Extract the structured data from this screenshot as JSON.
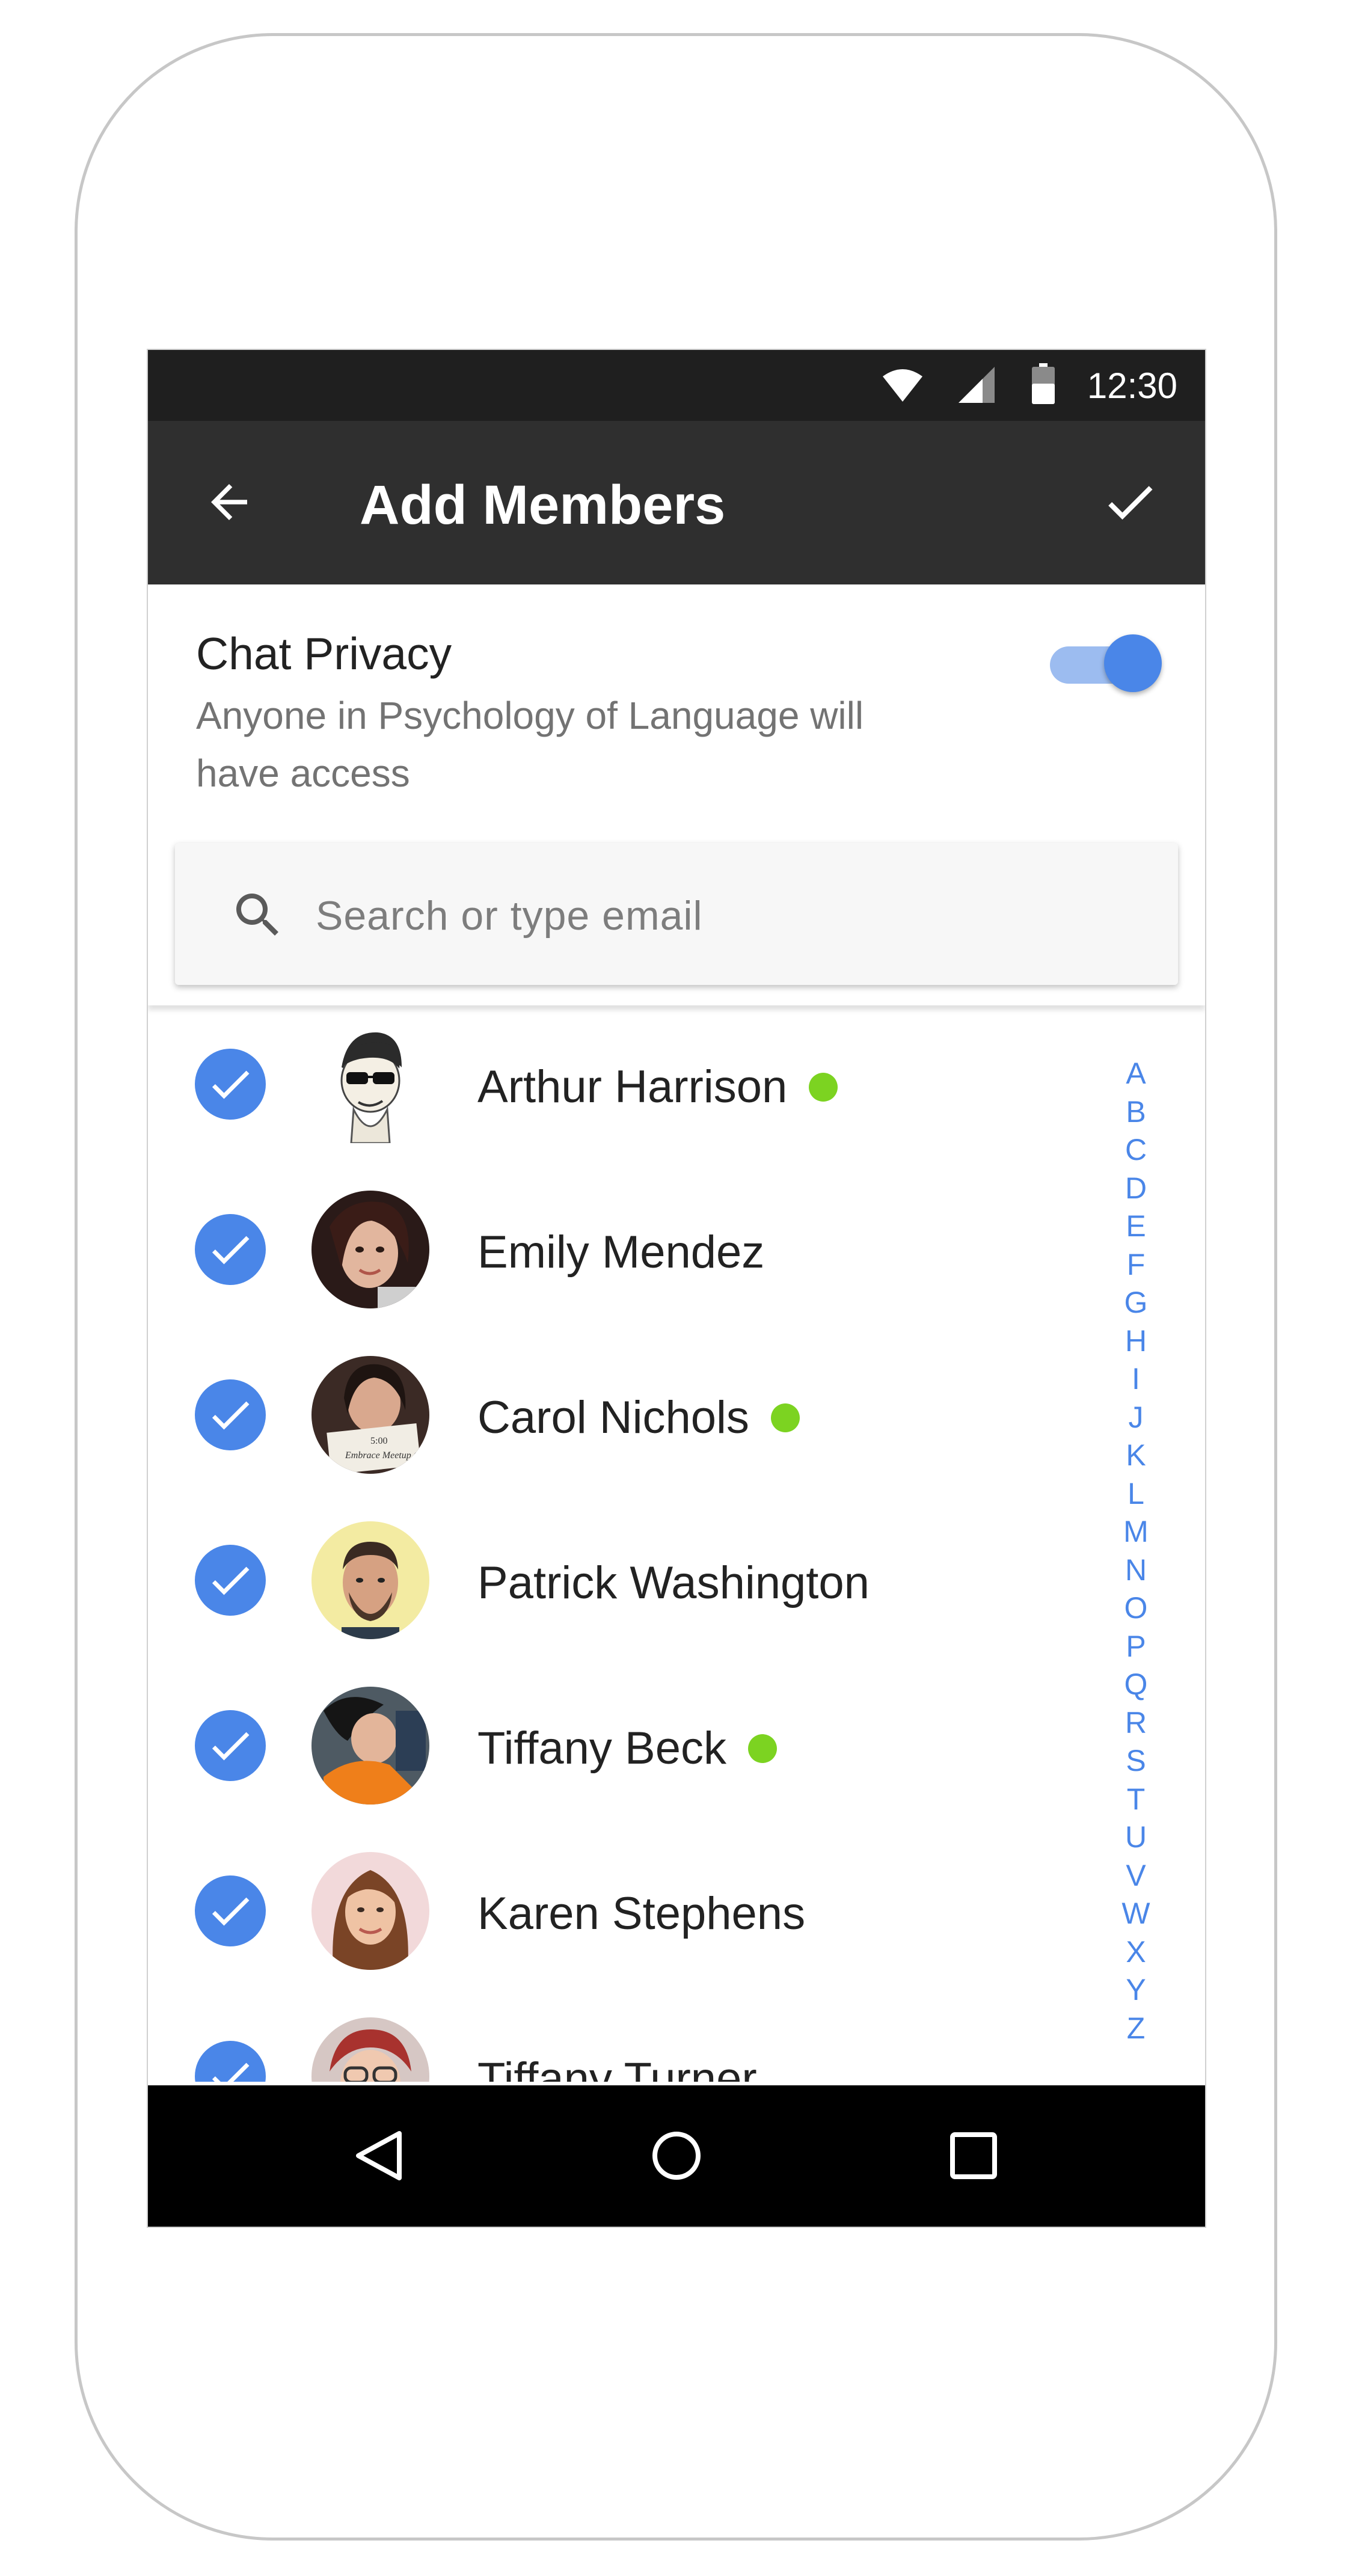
{
  "status_bar": {
    "time": "12:30"
  },
  "app_bar": {
    "title": "Add Members"
  },
  "privacy": {
    "title": "Chat Privacy",
    "description": "Anyone in Psychology of Language will have access",
    "enabled": true
  },
  "search": {
    "placeholder": "Search or type email"
  },
  "members": [
    {
      "name": "Arthur Harrison",
      "online": true,
      "checked": true
    },
    {
      "name": "Emily Mendez",
      "online": false,
      "checked": true
    },
    {
      "name": "Carol Nichols",
      "online": true,
      "checked": true
    },
    {
      "name": "Patrick Washington",
      "online": false,
      "checked": true
    },
    {
      "name": "Tiffany Beck",
      "online": true,
      "checked": true
    },
    {
      "name": "Karen Stephens",
      "online": false,
      "checked": true
    },
    {
      "name": "Tiffany Turner",
      "online": false,
      "checked": true
    }
  ],
  "alphabet_index": [
    "A",
    "B",
    "C",
    "D",
    "E",
    "F",
    "G",
    "H",
    "I",
    "J",
    "K",
    "L",
    "M",
    "N",
    "O",
    "P",
    "Q",
    "R",
    "S",
    "T",
    "U",
    "V",
    "W",
    "X",
    "Y",
    "Z"
  ],
  "colors": {
    "accent": "#4a86e8",
    "online": "#7cd321",
    "app_bar": "#2f2f2f",
    "status_bar": "#1f1f1f"
  }
}
